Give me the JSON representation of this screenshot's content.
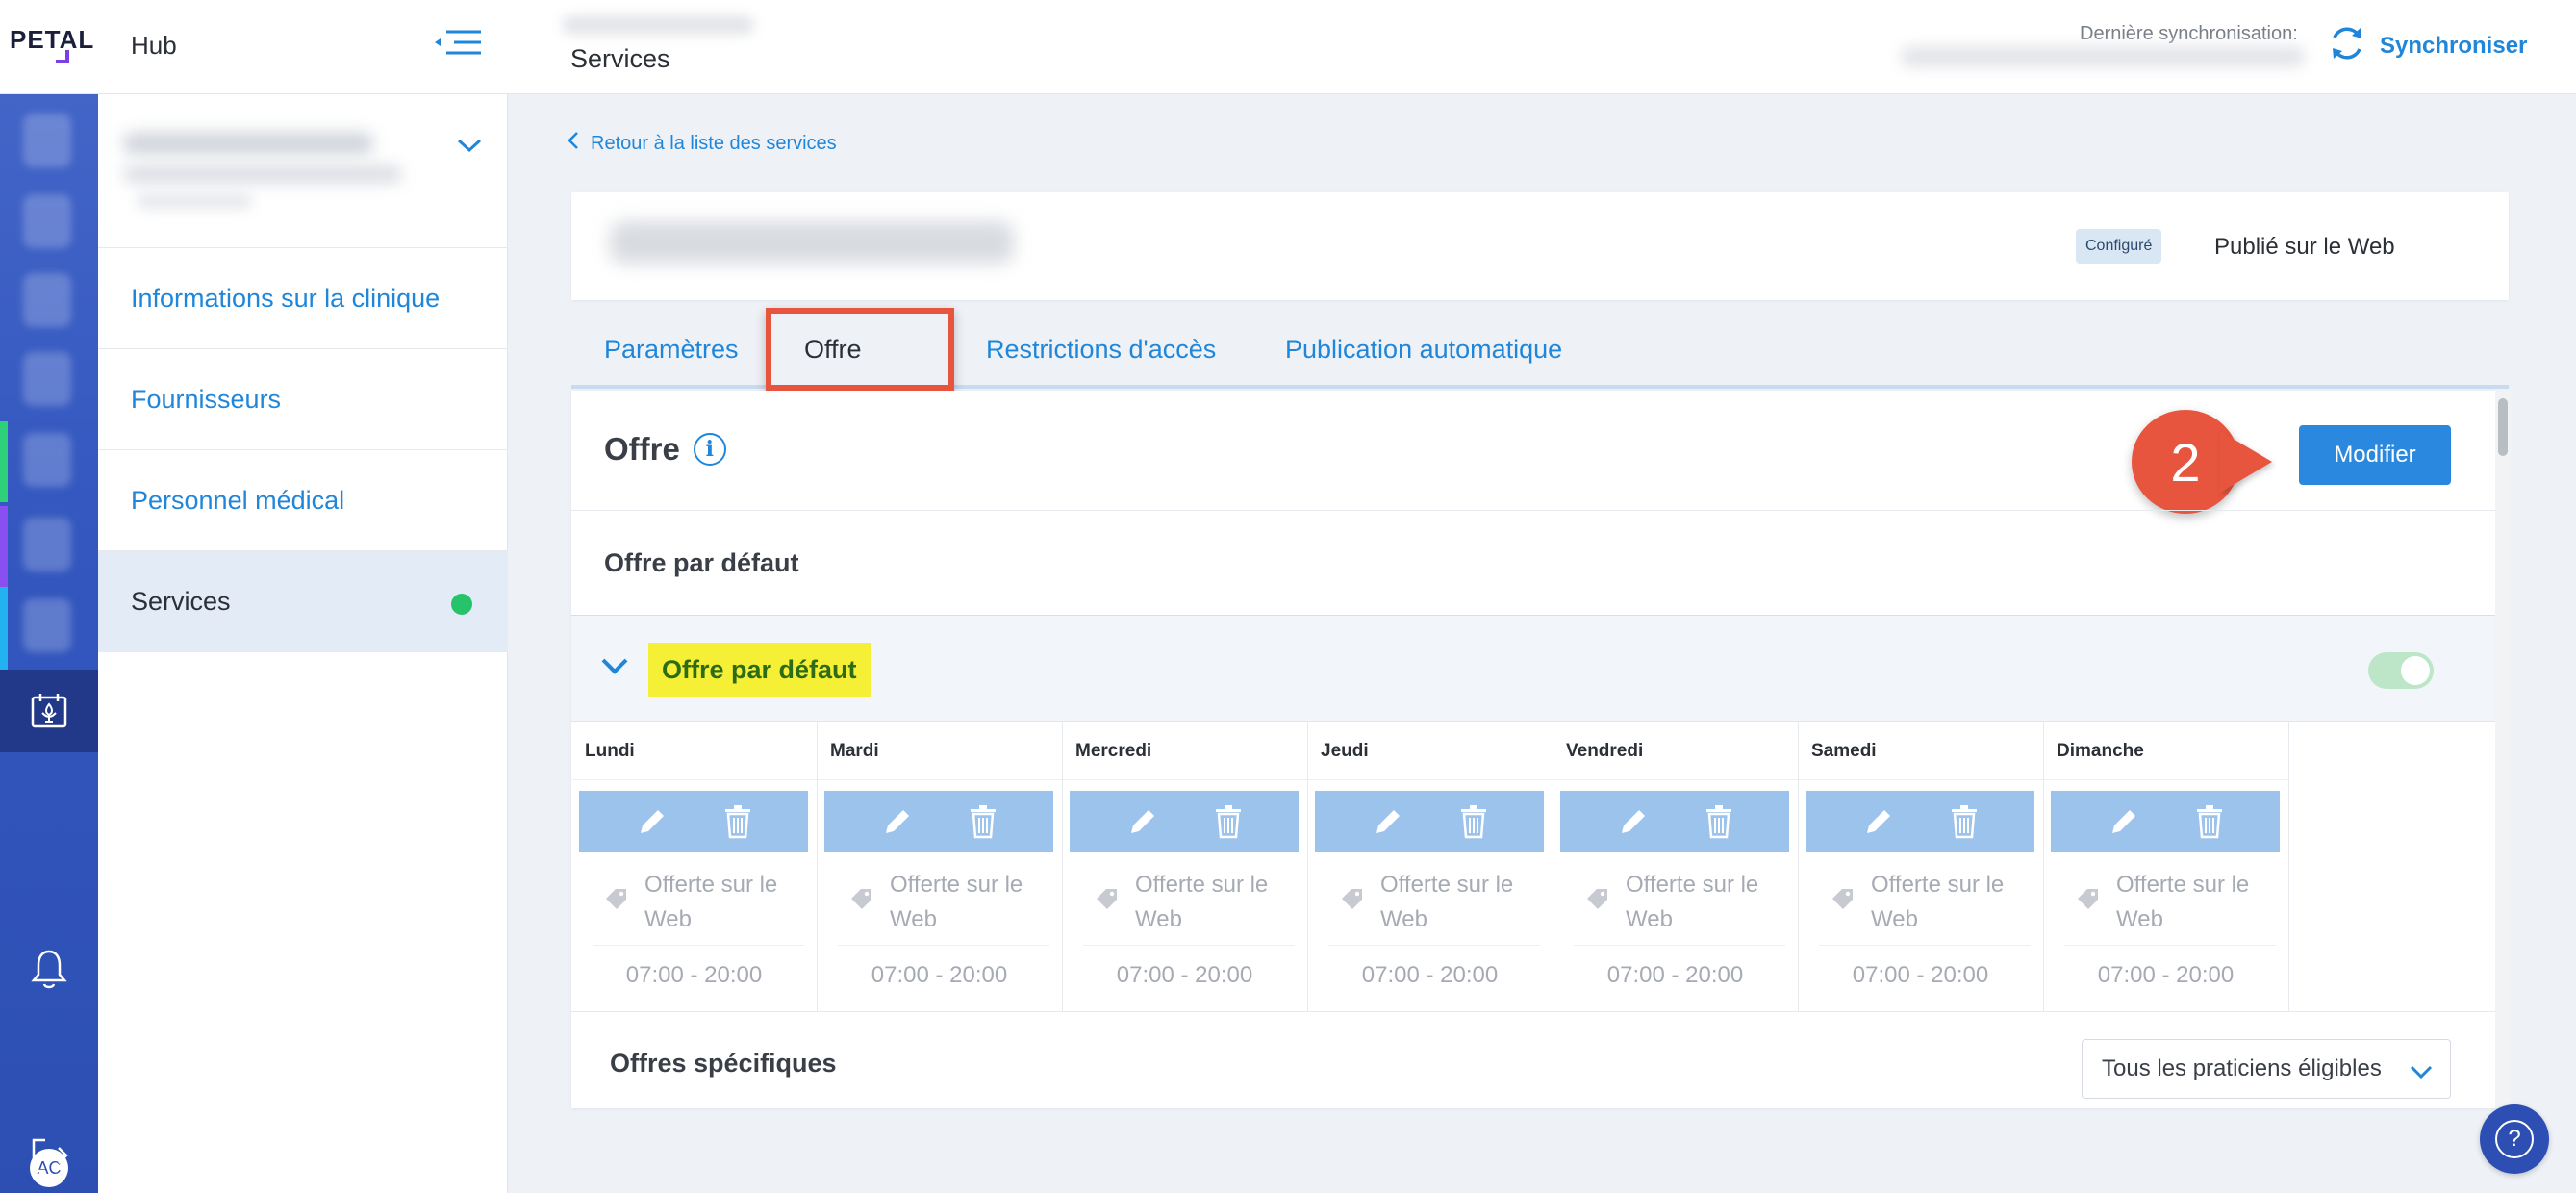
{
  "header": {
    "logo_text": "PETAL",
    "app_title": "Hub",
    "page_title": "Services",
    "last_sync_label": "Dernière synchronisation:",
    "sync_button": "Synchroniser"
  },
  "sidebar": {
    "items": [
      {
        "label": "Informations sur la clinique"
      },
      {
        "label": "Fournisseurs"
      },
      {
        "label": "Personnel médical"
      },
      {
        "label": "Services",
        "active": true
      }
    ]
  },
  "rail": {
    "avatar_initials": "AC"
  },
  "main": {
    "back_link": "Retour à la liste des services",
    "status_badge": "Configuré",
    "published_label": "Publié sur le Web",
    "tabs": [
      {
        "label": "Paramètres"
      },
      {
        "label": "Offre",
        "active": true
      },
      {
        "label": "Restrictions d'accès"
      },
      {
        "label": "Publication automatique"
      }
    ],
    "panel_title": "Offre",
    "info_glyph": "i",
    "modify_button": "Modifier",
    "step_number": "2",
    "default_section_title": "Offre par défaut",
    "default_offer_name": "Offre par défaut",
    "days": [
      {
        "name": "Lundi",
        "web_label": "Offerte sur le Web",
        "hours": "07:00 - 20:00"
      },
      {
        "name": "Mardi",
        "web_label": "Offerte sur le Web",
        "hours": "07:00 - 20:00"
      },
      {
        "name": "Mercredi",
        "web_label": "Offerte sur le Web",
        "hours": "07:00 - 20:00"
      },
      {
        "name": "Jeudi",
        "web_label": "Offerte sur le Web",
        "hours": "07:00 - 20:00"
      },
      {
        "name": "Vendredi",
        "web_label": "Offerte sur le Web",
        "hours": "07:00 - 20:00"
      },
      {
        "name": "Samedi",
        "web_label": "Offerte sur le Web",
        "hours": "07:00 - 20:00"
      },
      {
        "name": "Dimanche",
        "web_label": "Offerte sur le Web",
        "hours": "07:00 - 20:00"
      }
    ],
    "specific_offers_title": "Offres spécifiques",
    "practitioner_filter": "Tous les praticiens éligibles"
  },
  "help": {
    "glyph": "?"
  },
  "colors": {
    "accent": "#1f86d9",
    "rail": "#3357bf",
    "annotation": "#e8553f",
    "highlight": "#f5ef35",
    "active_dot": "#27c36a"
  }
}
